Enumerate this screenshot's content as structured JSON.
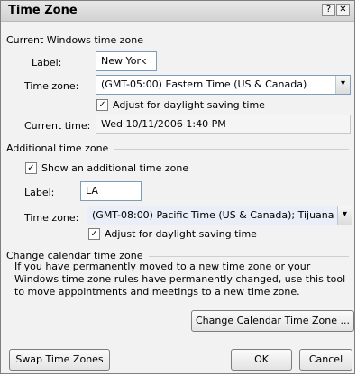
{
  "window": {
    "title": "Time Zone",
    "help_glyph": "?",
    "close_glyph": "✕"
  },
  "current": {
    "section_title": "Current Windows time zone",
    "label_caption": "Label:",
    "label_value": "New York",
    "tz_caption": "Time zone:",
    "tz_value": "(GMT-05:00) Eastern Time (US & Canada)",
    "dst_checked": true,
    "dst_label": "Adjust for daylight saving time",
    "current_time_caption": "Current time:",
    "current_time_value": "Wed 10/11/2006 1:40 PM"
  },
  "additional": {
    "section_title": "Additional time zone",
    "show_checked": true,
    "show_label": "Show an additional time zone",
    "label_caption": "Label:",
    "label_value": "LA",
    "tz_caption": "Time zone:",
    "tz_value": "(GMT-08:00) Pacific Time (US & Canada); Tijuana",
    "dst_checked": true,
    "dst_label": "Adjust for daylight saving time"
  },
  "change": {
    "section_title": "Change calendar time zone",
    "description": "If you have permanently moved to a new time zone or your Windows time zone rules have permanently changed, use this tool to move appointments and meetings to a new time zone.",
    "button_label": "Change Calendar Time Zone ..."
  },
  "footer": {
    "swap_label": "Swap Time Zones",
    "ok_label": "OK",
    "cancel_label": "Cancel"
  }
}
